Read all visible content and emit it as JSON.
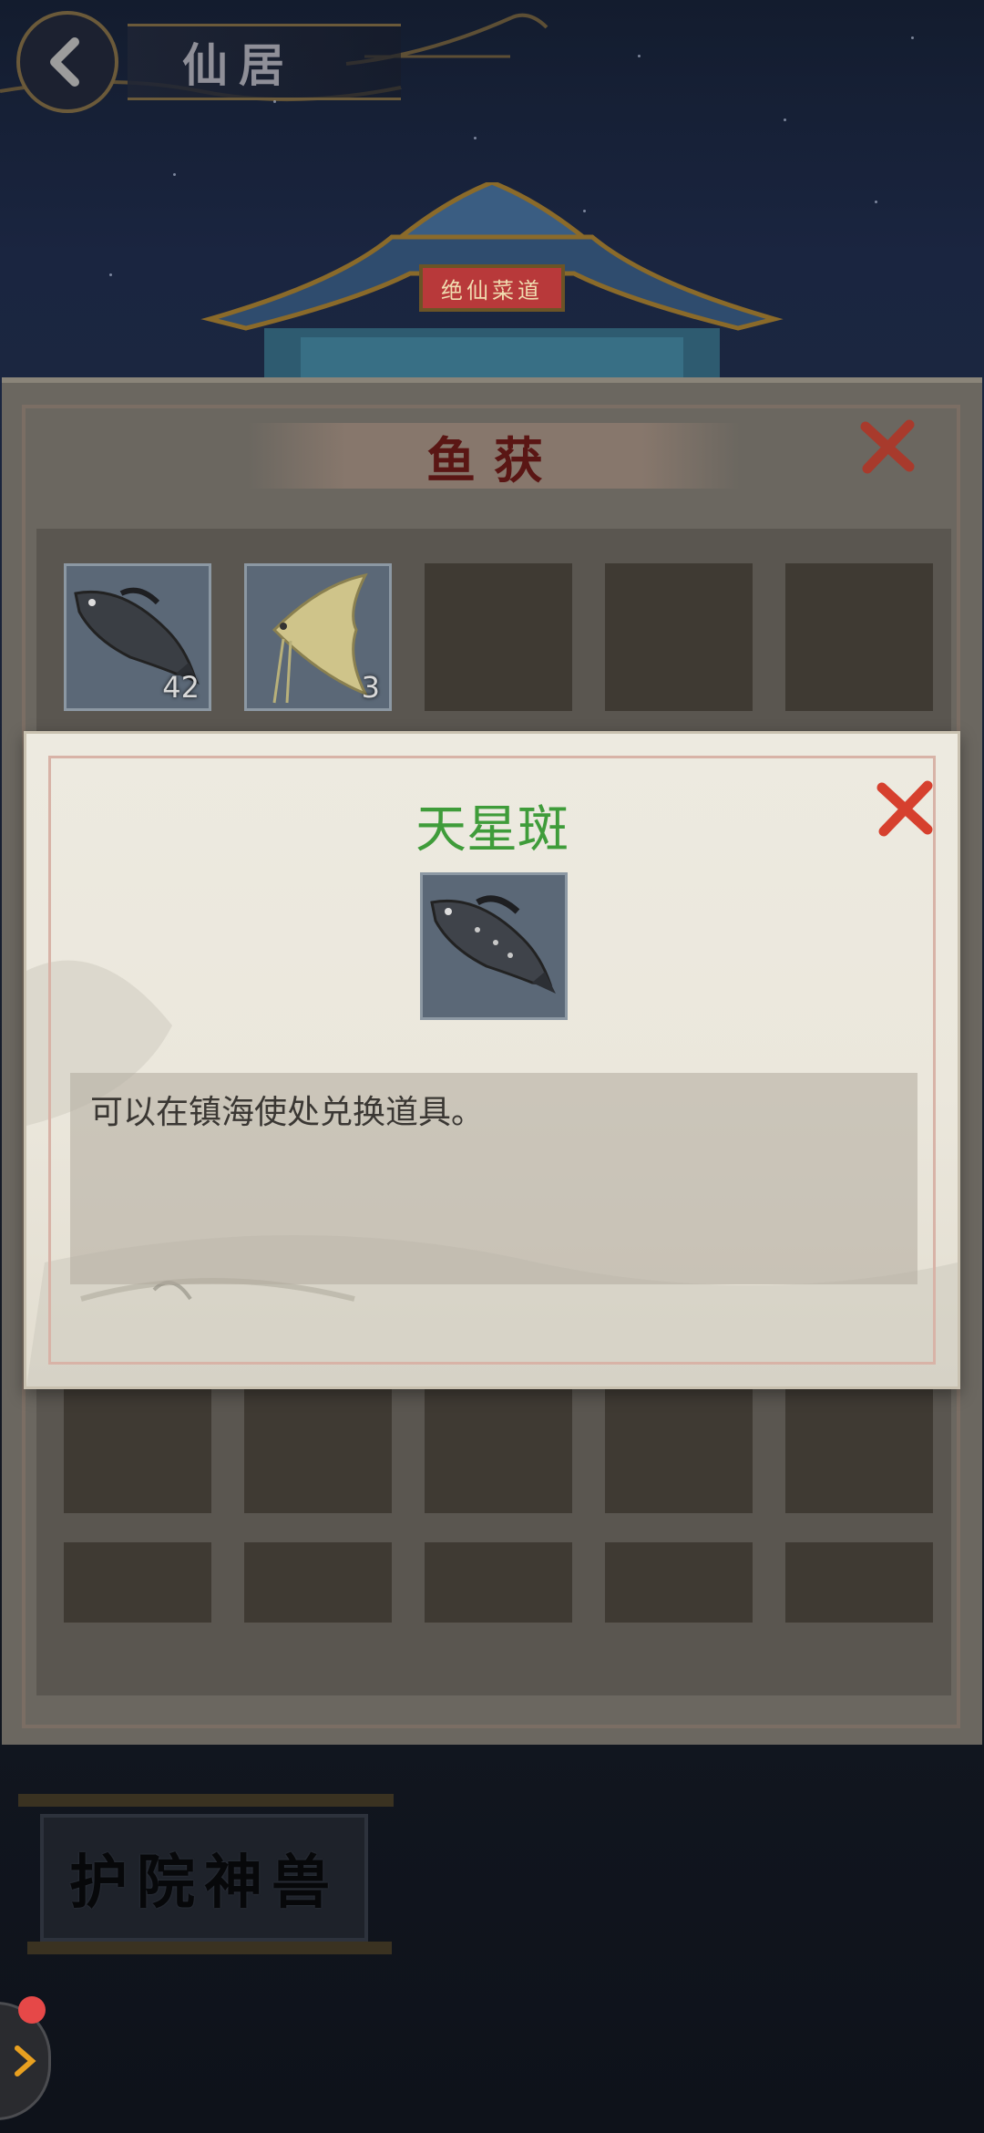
{
  "top_bar": {
    "title": "仙居"
  },
  "palace": {
    "plaque_text": "绝仙菜道"
  },
  "catch_panel": {
    "title": "鱼获",
    "slots": [
      {
        "item": "grouper-fish",
        "count": "42"
      },
      {
        "item": "angelfish",
        "count": "3"
      }
    ]
  },
  "detail_popup": {
    "item_name": "天星斑",
    "description": "可以在镇海使处兑换道具。",
    "title_color": "#3f9c3a"
  },
  "bottom": {
    "guard_plaque": "护院神兽"
  },
  "colors": {
    "close_red": "#d6402e",
    "notification_dot": "#e64848"
  },
  "icons": [
    "back-arrow-icon",
    "close-icon",
    "fish-icon",
    "chevron-right-icon"
  ]
}
